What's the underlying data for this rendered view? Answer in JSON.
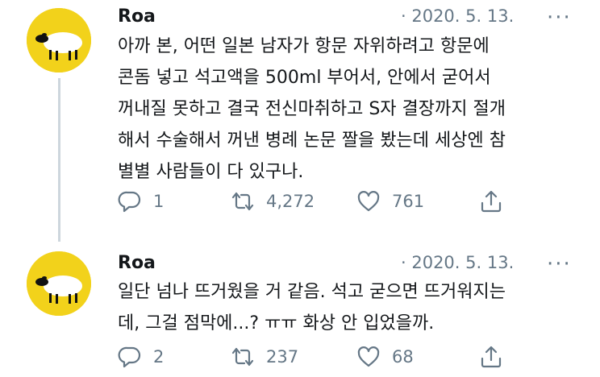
{
  "colors": {
    "name": "#14171a",
    "muted": "#657786",
    "avatar_bg": "#f2d21b",
    "thread_line": "#cdd6dd"
  },
  "tweets": [
    {
      "author": "Roa",
      "date": "· 2020. 5. 13.",
      "more_label": "···",
      "text": "아까 본, 어떤 일본 남자가 항문 자위하려고 항문에\n콘돔 넣고 석고액을 500ml 부어서, 안에서 굳어서\n꺼내질 못하고 결국 전신마취하고 S자 결장까지 절개\n해서 수술해서 꺼낸 병례 논문 짤을 봤는데 세상엔 참\n별별 사람들이 다 있구나.",
      "replies": "1",
      "retweets": "4,272",
      "likes": "761"
    },
    {
      "author": "Roa",
      "date": "· 2020. 5. 13.",
      "more_label": "···",
      "text": "일단 넘나 뜨거웠을 거 같음. 석고 굳으면 뜨거워지는\n데, 그걸 점막에...? ㅠㅠ 화상 안 입었을까.",
      "replies": "2",
      "retweets": "237",
      "likes": "68"
    }
  ],
  "icons": {
    "avatar": "sheep-avatar",
    "reply": "reply-icon",
    "retweet": "retweet-icon",
    "like": "heart-icon",
    "share": "share-icon"
  }
}
